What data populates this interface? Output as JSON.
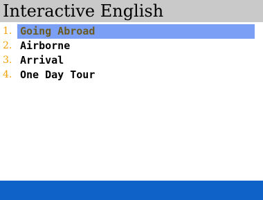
{
  "app": {
    "title": "Interactive English"
  },
  "menu": {
    "items": [
      {
        "number": "1.",
        "label": "Going Abroad",
        "selected": true
      },
      {
        "number": "2.",
        "label": "Airborne",
        "selected": false
      },
      {
        "number": "3.",
        "label": "Arrival",
        "selected": false
      },
      {
        "number": "4.",
        "label": "One Day Tour",
        "selected": false
      }
    ]
  },
  "colors": {
    "title_bar": "#c9c9c9",
    "selection": "#7a9ff5",
    "number": "#f2a000",
    "status_bar": "#0f63c8"
  }
}
